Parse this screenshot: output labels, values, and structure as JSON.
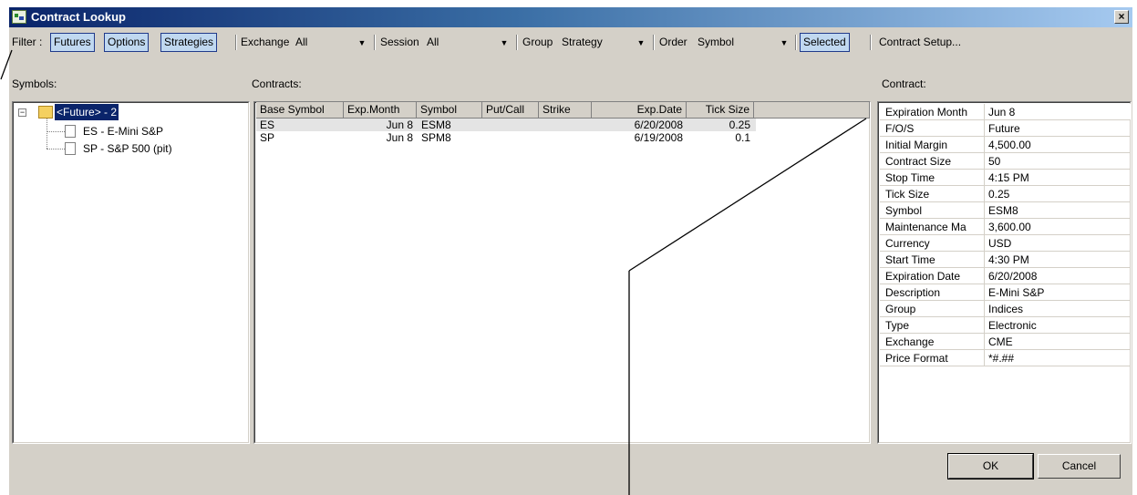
{
  "window": {
    "title": "Contract Lookup",
    "close_glyph": "×"
  },
  "filter": {
    "label": "Filter :",
    "buttons": [
      "Futures",
      "Options",
      "Strategies"
    ]
  },
  "exchange": {
    "label": "Exchange",
    "value": "All"
  },
  "session": {
    "label": "Session",
    "value": "All"
  },
  "group": {
    "label": "Group",
    "value": "Strategy"
  },
  "order": {
    "label": "Order",
    "value": "Symbol"
  },
  "selected_button": "Selected",
  "contract_setup": "Contract Setup...",
  "symbols": {
    "label": "Symbols:",
    "root": "<Future> - 2",
    "children": [
      "ES - E-Mini S&P",
      "SP - S&P 500 (pit)"
    ]
  },
  "contracts": {
    "label": "Contracts:",
    "columns": [
      "Base Symbol",
      "Exp.Month",
      "Symbol",
      "Put/Call",
      "Strike",
      "Exp.Date",
      "Tick Size"
    ],
    "rows": [
      [
        "ES",
        "Jun 8",
        "ESM8",
        "",
        "",
        "6/20/2008",
        "0.25"
      ],
      [
        "SP",
        "Jun 8",
        "SPM8",
        "",
        "",
        "6/19/2008",
        "0.1"
      ]
    ]
  },
  "contract": {
    "label": "Contract:",
    "properties": [
      [
        "Expiration Month",
        "Jun 8"
      ],
      [
        "F/O/S",
        "Future"
      ],
      [
        "Initial Margin",
        "4,500.00"
      ],
      [
        "Contract Size",
        "50"
      ],
      [
        "Stop Time",
        "4:15 PM"
      ],
      [
        "Tick Size",
        "0.25"
      ],
      [
        "Symbol",
        "ESM8"
      ],
      [
        "Maintenance Ma",
        "3,600.00"
      ],
      [
        "Currency",
        "USD"
      ],
      [
        "Start Time",
        "4:30 PM"
      ],
      [
        "Expiration Date",
        "6/20/2008"
      ],
      [
        "Description",
        "E-Mini S&P"
      ],
      [
        "Group",
        "Indices"
      ],
      [
        "Type",
        "Electronic"
      ],
      [
        "Exchange",
        "CME"
      ],
      [
        "Price Format",
        "*#.##"
      ]
    ]
  },
  "buttons": {
    "ok": "OK",
    "cancel": "Cancel"
  },
  "dropdown_glyph": "▼",
  "expander_glyph": "−",
  "colors": {
    "title_start": "#0a246a",
    "title_end": "#a6caf0",
    "selection": "#0a246a",
    "dialog": "#d4d0c8"
  }
}
